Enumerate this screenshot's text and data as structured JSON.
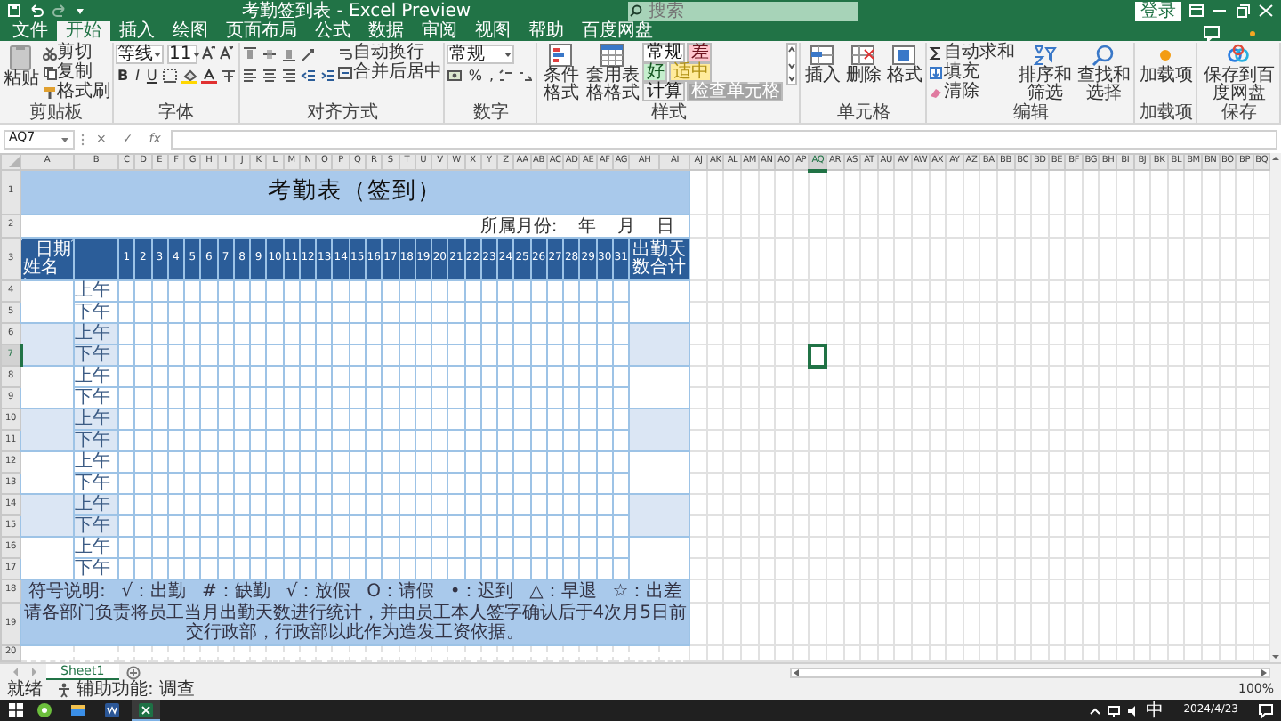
{
  "title_bar": {
    "title": "考勤签到表 - Excel Preview",
    "search": {
      "placeholder": "搜索"
    },
    "sign_in": "登录"
  },
  "ribbon_tabs": [
    {
      "label": "文件",
      "selected": false
    },
    {
      "label": "开始",
      "selected": true
    },
    {
      "label": "插入",
      "selected": false
    },
    {
      "label": "绘图",
      "selected": false
    },
    {
      "label": "页面布局",
      "selected": false
    },
    {
      "label": "公式",
      "selected": false
    },
    {
      "label": "数据",
      "selected": false
    },
    {
      "label": "审阅",
      "selected": false
    },
    {
      "label": "视图",
      "selected": false
    },
    {
      "label": "帮助",
      "selected": false
    },
    {
      "label": "百度网盘",
      "selected": false
    }
  ],
  "ribbon": {
    "clipboard": {
      "label": "剪贴板",
      "paste": "粘贴",
      "cut": "剪切",
      "copy": "复制",
      "format_painter": "格式刷"
    },
    "font": {
      "label": "字体",
      "font_name": "等线",
      "font_size": "11",
      "bold": "B",
      "italic": "I",
      "underline": "U"
    },
    "alignment": {
      "label": "对齐方式",
      "wrap_text": "自动换行",
      "merge_center": "合并后居中"
    },
    "number": {
      "label": "数字",
      "format": "常规",
      "percent": "%",
      "comma": ","
    },
    "styles": {
      "label": "样式",
      "conditional_formatting": "条件格式",
      "format_as_table": "套用表格格式",
      "cell_styles": [
        {
          "label": "常规",
          "color": "#ffffff"
        },
        {
          "label": "差",
          "color": "#ffc7ce"
        },
        {
          "label": "好",
          "color": "#c6efce"
        },
        {
          "label": "适中",
          "color": "#ffeb9c"
        },
        {
          "label": "计算",
          "color": "#f2f2f2"
        },
        {
          "label": "检查单元格",
          "color": "#a5a5a5"
        }
      ]
    },
    "cells": {
      "label": "单元格",
      "buttons": [
        "插入",
        "删除",
        "格式"
      ]
    },
    "editing": {
      "label": "编辑",
      "autosum": "自动求和",
      "fill": "填充",
      "clear": "清除",
      "sort_filter": "排序和筛选",
      "find_select": "查找和选择"
    },
    "addins": {
      "label": "加载项",
      "button": "加载项"
    },
    "save": {
      "label": "保存",
      "button": "保存到百度网盘"
    }
  },
  "formula_bar": {
    "name_box": "AQ7",
    "cancel": "×",
    "enter": "✓",
    "function": "fx"
  },
  "columns": [
    {
      "label": "A",
      "selected": false
    },
    {
      "label": "B",
      "selected": false
    },
    {
      "label": "C",
      "selected": false
    },
    {
      "label": "D",
      "selected": false
    },
    {
      "label": "E",
      "selected": false
    },
    {
      "label": "F",
      "selected": false
    },
    {
      "label": "G",
      "selected": false
    },
    {
      "label": "H",
      "selected": false
    },
    {
      "label": "I",
      "selected": false
    },
    {
      "label": "J",
      "selected": false
    },
    {
      "label": "K",
      "selected": false
    },
    {
      "label": "L",
      "selected": false
    },
    {
      "label": "M",
      "selected": false
    },
    {
      "label": "N",
      "selected": false
    },
    {
      "label": "O",
      "selected": false
    },
    {
      "label": "P",
      "selected": false
    },
    {
      "label": "Q",
      "selected": false
    },
    {
      "label": "R",
      "selected": false
    },
    {
      "label": "S",
      "selected": false
    },
    {
      "label": "T",
      "selected": false
    },
    {
      "label": "U",
      "selected": false
    },
    {
      "label": "V",
      "selected": false
    },
    {
      "label": "W",
      "selected": false
    },
    {
      "label": "X",
      "selected": false
    },
    {
      "label": "Y",
      "selected": false
    },
    {
      "label": "Z",
      "selected": false
    },
    {
      "label": "AA",
      "selected": false
    },
    {
      "label": "AB",
      "selected": false
    },
    {
      "label": "AC",
      "selected": false
    },
    {
      "label": "AD",
      "selected": false
    },
    {
      "label": "AE",
      "selected": false
    },
    {
      "label": "AF",
      "selected": false
    },
    {
      "label": "AG",
      "selected": false
    },
    {
      "label": "AH",
      "selected": false
    },
    {
      "label": "AI",
      "selected": false
    },
    {
      "label": "AJ",
      "selected": false
    },
    {
      "label": "AK",
      "selected": false
    },
    {
      "label": "AL",
      "selected": false
    },
    {
      "label": "AM",
      "selected": false
    },
    {
      "label": "AN",
      "selected": false
    },
    {
      "label": "AO",
      "selected": false
    },
    {
      "label": "AP",
      "selected": false
    },
    {
      "label": "AQ",
      "selected": true
    },
    {
      "label": "AR",
      "selected": false
    },
    {
      "label": "AS",
      "selected": false
    },
    {
      "label": "AT",
      "selected": false
    },
    {
      "label": "AU",
      "selected": false
    },
    {
      "label": "AV",
      "selected": false
    },
    {
      "label": "AW",
      "selected": false
    },
    {
      "label": "AX",
      "selected": false
    },
    {
      "label": "AY",
      "selected": false
    },
    {
      "label": "AZ",
      "selected": false
    },
    {
      "label": "BA",
      "selected": false
    },
    {
      "label": "BB",
      "selected": false
    },
    {
      "label": "BC",
      "selected": false
    },
    {
      "label": "BD",
      "selected": false
    },
    {
      "label": "BE",
      "selected": false
    },
    {
      "label": "BF",
      "selected": false
    },
    {
      "label": "BG",
      "selected": false
    },
    {
      "label": "BH",
      "selected": false
    },
    {
      "label": "BI",
      "selected": false
    },
    {
      "label": "BJ",
      "selected": false
    },
    {
      "label": "BK",
      "selected": false
    },
    {
      "label": "BL",
      "selected": false
    },
    {
      "label": "BM",
      "selected": false
    },
    {
      "label": "BN",
      "selected": false
    },
    {
      "label": "BO",
      "selected": false
    },
    {
      "label": "BP",
      "selected": false
    },
    {
      "label": "BQ",
      "selected": false
    }
  ],
  "rows": [
    {
      "label": "1",
      "selected": false
    },
    {
      "label": "2",
      "selected": false
    },
    {
      "label": "3",
      "selected": false
    },
    {
      "label": "4",
      "selected": false
    },
    {
      "label": "5",
      "selected": false
    },
    {
      "label": "6",
      "selected": false
    },
    {
      "label": "7",
      "selected": true
    },
    {
      "label": "8",
      "selected": false
    },
    {
      "label": "9",
      "selected": false
    },
    {
      "label": "10",
      "selected": false
    },
    {
      "label": "11",
      "selected": false
    },
    {
      "label": "12",
      "selected": false
    },
    {
      "label": "13",
      "selected": false
    },
    {
      "label": "14",
      "selected": false
    },
    {
      "label": "15",
      "selected": false
    },
    {
      "label": "16",
      "selected": false
    },
    {
      "label": "17",
      "selected": false
    },
    {
      "label": "18",
      "selected": false
    },
    {
      "label": "19",
      "selected": false
    },
    {
      "label": "20",
      "selected": false
    }
  ],
  "sheet": {
    "title": "考勤表（签到）",
    "month_label": "所属月份:",
    "year": "年",
    "month": "月",
    "day": "日",
    "header": {
      "date": "日期",
      "name": "姓名",
      "days": [
        "1",
        "2",
        "3",
        "4",
        "5",
        "6",
        "7",
        "8",
        "9",
        "10",
        "11",
        "12",
        "13",
        "14",
        "15",
        "16",
        "17",
        "18",
        "19",
        "20",
        "21",
        "22",
        "23",
        "24",
        "25",
        "26",
        "27",
        "28",
        "29",
        "30",
        "31"
      ],
      "total": "出勤天数合计"
    },
    "employees": [
      {
        "shaded": false,
        "periods": [
          "上午",
          "下午"
        ]
      },
      {
        "shaded": true,
        "periods": [
          "上午",
          "下午"
        ]
      },
      {
        "shaded": false,
        "periods": [
          "上午",
          "下午"
        ]
      },
      {
        "shaded": true,
        "periods": [
          "上午",
          "下午"
        ]
      },
      {
        "shaded": false,
        "periods": [
          "上午",
          "下午"
        ]
      },
      {
        "shaded": true,
        "periods": [
          "上午",
          "下午"
        ]
      },
      {
        "shaded": false,
        "periods": [
          "上午",
          "下午"
        ]
      }
    ],
    "legend": [
      "符号说明:",
      "√：出勤",
      "#：缺勤",
      "√：放假",
      "O：请假",
      "•：迟到",
      "△：早退",
      "☆：出差"
    ],
    "note": "请各部门负责将员工当月出勤天数进行统计，并由员工本人签字确认后于4次月5日前交行政部，行政部以此作为造发工资依据。"
  },
  "sheet_tabs": [
    {
      "label": "Sheet1",
      "selected": true
    }
  ],
  "status_bar": {
    "ready": "就绪",
    "accessibility": "辅助功能: 调查",
    "zoom": "100%"
  },
  "taskbar": {
    "apps": [
      {
        "selected": false
      },
      {
        "selected": false
      },
      {
        "selected": false
      },
      {
        "selected": true
      }
    ],
    "ime": "中",
    "date": "2024/4/23"
  }
}
